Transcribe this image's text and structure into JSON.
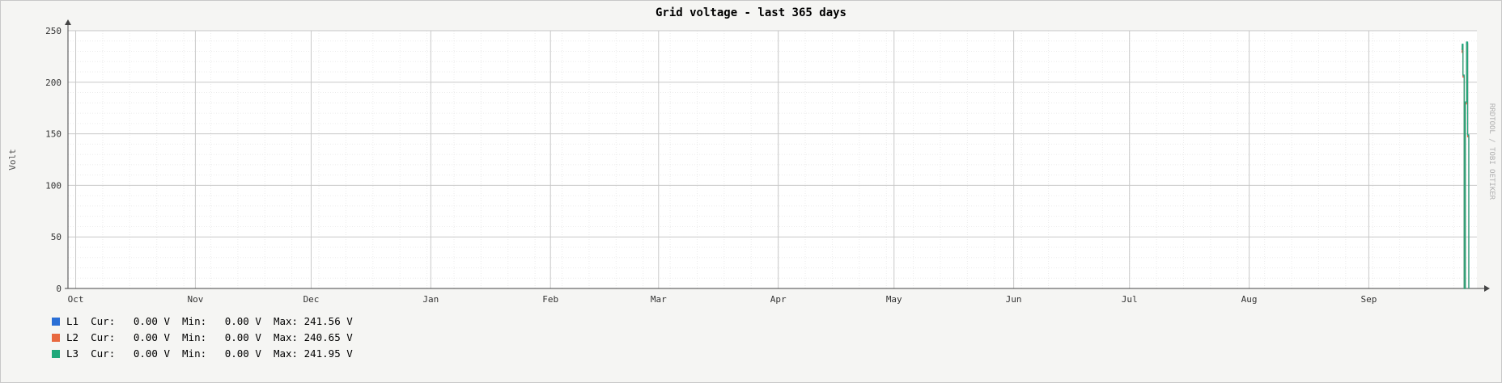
{
  "chart_data": {
    "type": "line",
    "title": "Grid voltage - last 365 days",
    "ylabel": "Volt",
    "xlabel": "",
    "watermark": "RRDTOOL / TOBI OETIKER",
    "ylim": [
      0,
      250
    ],
    "y_ticks": [
      0,
      50,
      100,
      150,
      200,
      250
    ],
    "x_tick_labels": [
      "Oct",
      "Nov",
      "Dec",
      "Jan",
      "Feb",
      "Mar",
      "Apr",
      "May",
      "Jun",
      "Jul",
      "Aug",
      "Sep"
    ],
    "x_tick_days": [
      0,
      31,
      61,
      92,
      123,
      151,
      182,
      212,
      243,
      273,
      304,
      335
    ],
    "x_range_days": [
      -2,
      363
    ],
    "grid": true,
    "colors": {
      "L1": "#2a6fd6",
      "L2": "#e8683f",
      "L3": "#1fa87a"
    },
    "series": [
      {
        "name": "L1",
        "color": "#2a6fd6",
        "x": [
          359.0,
          359.2,
          359.4,
          359.7,
          360.0,
          360.3,
          360.6,
          360.9
        ],
        "y": [
          230,
          236,
          206,
          0,
          180,
          238,
          148,
          0
        ]
      },
      {
        "name": "L2",
        "color": "#e8683f",
        "x": [
          359.0,
          359.2,
          359.4,
          359.7,
          360.0,
          360.3,
          360.6,
          360.9
        ],
        "y": [
          229,
          235,
          205,
          0,
          179,
          237,
          147,
          0
        ]
      },
      {
        "name": "L3",
        "color": "#1fa87a",
        "x": [
          359.0,
          359.2,
          359.4,
          359.7,
          360.0,
          360.3,
          360.6,
          360.9
        ],
        "y": [
          232,
          237,
          207,
          0,
          181,
          239,
          149,
          0
        ]
      }
    ]
  },
  "legend": [
    {
      "name": "L1",
      "cur_label": "Cur:",
      "cur": "0.00 V",
      "min_label": "Min:",
      "min": "0.00 V",
      "max_label": "Max:",
      "max": "241.56 V",
      "color": "#2a6fd6"
    },
    {
      "name": "L2",
      "cur_label": "Cur:",
      "cur": "0.00 V",
      "min_label": "Min:",
      "min": "0.00 V",
      "max_label": "Max:",
      "max": "240.65 V",
      "color": "#e8683f"
    },
    {
      "name": "L3",
      "cur_label": "Cur:",
      "cur": "0.00 V",
      "min_label": "Min:",
      "min": "0.00 V",
      "max_label": "Max:",
      "max": "241.95 V",
      "color": "#1fa87a"
    }
  ]
}
